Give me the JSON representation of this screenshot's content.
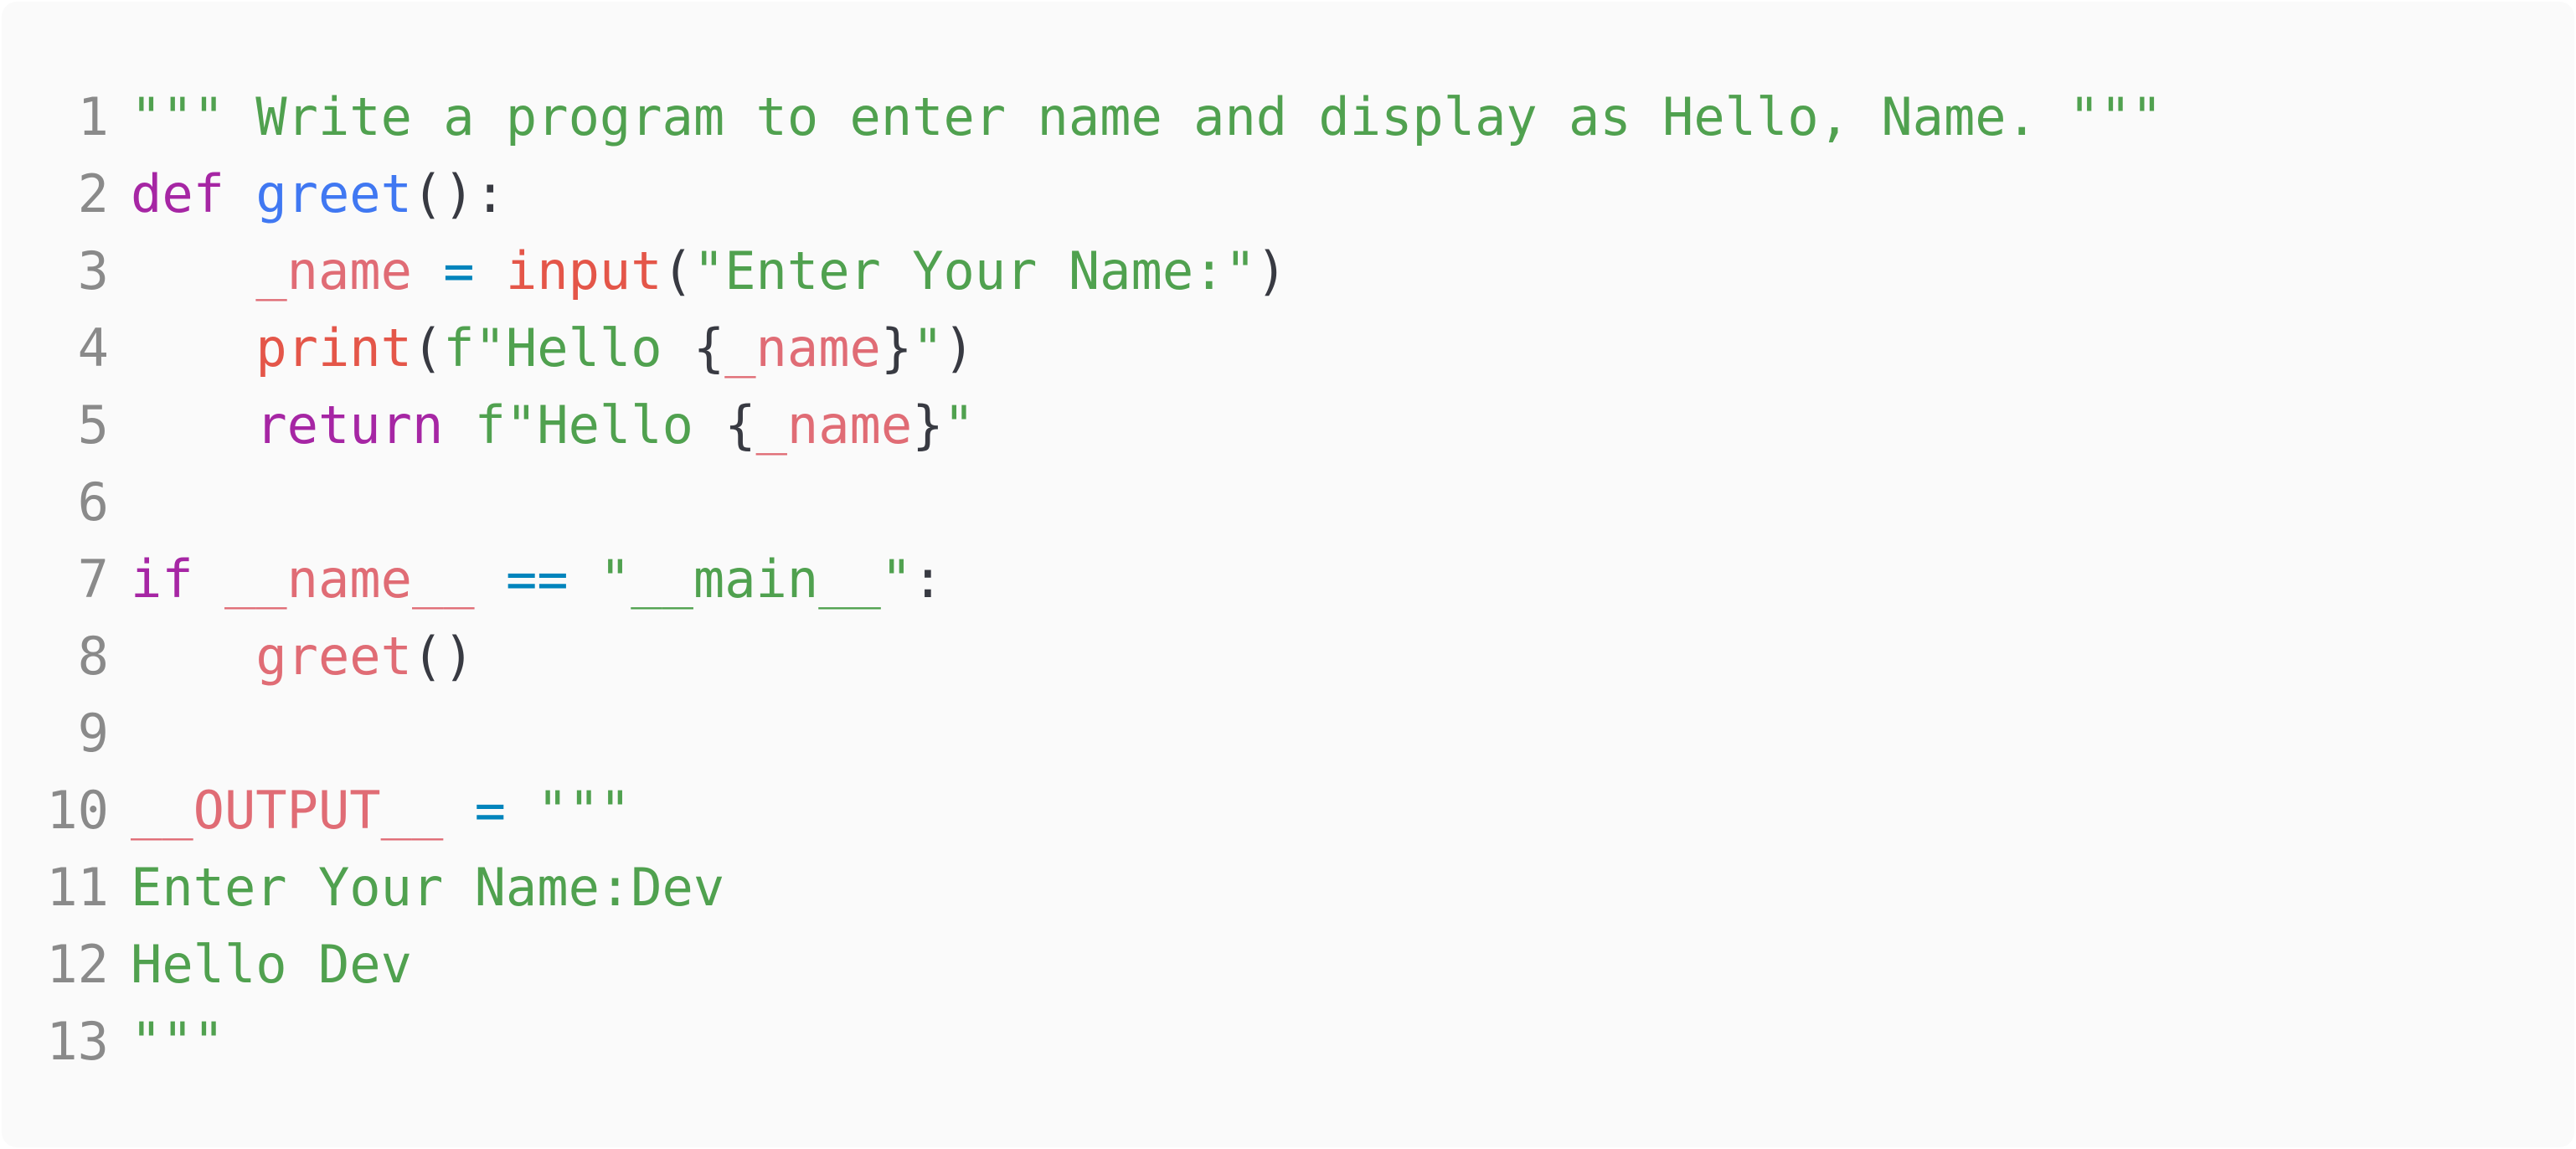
{
  "colors": {
    "background": "#fafafa",
    "line_number": "#8a8a8a",
    "default": "#383a42",
    "keyword": "#a626a4",
    "function_def": "#4078f2",
    "identifier": "#e45649",
    "string": "#50a14f",
    "operator": "#0184bc",
    "call": "#e06c75"
  },
  "lines": [
    {
      "num": "1",
      "tokens": [
        {
          "t": "\"\"\" Write a program to enter name and display as Hello, Name. \"\"\"",
          "k": "string"
        }
      ]
    },
    {
      "num": "2",
      "tokens": [
        {
          "t": "def",
          "k": "keyword"
        },
        {
          "t": " ",
          "k": "default"
        },
        {
          "t": "greet",
          "k": "function_def"
        },
        {
          "t": "():",
          "k": "default"
        }
      ]
    },
    {
      "num": "3",
      "tokens": [
        {
          "t": "    ",
          "k": "default"
        },
        {
          "t": "_name",
          "k": "call"
        },
        {
          "t": " ",
          "k": "default"
        },
        {
          "t": "=",
          "k": "operator"
        },
        {
          "t": " ",
          "k": "default"
        },
        {
          "t": "input",
          "k": "identifier"
        },
        {
          "t": "(",
          "k": "default"
        },
        {
          "t": "\"Enter Your Name:\"",
          "k": "string"
        },
        {
          "t": ")",
          "k": "default"
        }
      ]
    },
    {
      "num": "4",
      "tokens": [
        {
          "t": "    ",
          "k": "default"
        },
        {
          "t": "print",
          "k": "identifier"
        },
        {
          "t": "(",
          "k": "default"
        },
        {
          "t": "f\"Hello ",
          "k": "string"
        },
        {
          "t": "{",
          "k": "default"
        },
        {
          "t": "_name",
          "k": "call"
        },
        {
          "t": "}",
          "k": "default"
        },
        {
          "t": "\"",
          "k": "string"
        },
        {
          "t": ")",
          "k": "default"
        }
      ]
    },
    {
      "num": "5",
      "tokens": [
        {
          "t": "    ",
          "k": "default"
        },
        {
          "t": "return",
          "k": "keyword"
        },
        {
          "t": " ",
          "k": "default"
        },
        {
          "t": "f\"Hello ",
          "k": "string"
        },
        {
          "t": "{",
          "k": "default"
        },
        {
          "t": "_name",
          "k": "call"
        },
        {
          "t": "}",
          "k": "default"
        },
        {
          "t": "\"",
          "k": "string"
        }
      ]
    },
    {
      "num": "6",
      "tokens": []
    },
    {
      "num": "7",
      "tokens": [
        {
          "t": "if",
          "k": "keyword"
        },
        {
          "t": " ",
          "k": "default"
        },
        {
          "t": "__name__",
          "k": "call"
        },
        {
          "t": " ",
          "k": "default"
        },
        {
          "t": "==",
          "k": "operator"
        },
        {
          "t": " ",
          "k": "default"
        },
        {
          "t": "\"__main__\"",
          "k": "string"
        },
        {
          "t": ":",
          "k": "default"
        }
      ]
    },
    {
      "num": "8",
      "tokens": [
        {
          "t": "    ",
          "k": "default"
        },
        {
          "t": "greet",
          "k": "call"
        },
        {
          "t": "()",
          "k": "default"
        }
      ]
    },
    {
      "num": "9",
      "tokens": []
    },
    {
      "num": "10",
      "tokens": [
        {
          "t": "__OUTPUT__",
          "k": "call"
        },
        {
          "t": " ",
          "k": "default"
        },
        {
          "t": "=",
          "k": "operator"
        },
        {
          "t": " ",
          "k": "default"
        },
        {
          "t": "\"\"\"",
          "k": "string"
        }
      ]
    },
    {
      "num": "11",
      "tokens": [
        {
          "t": "Enter Your Name:Dev",
          "k": "string"
        }
      ]
    },
    {
      "num": "12",
      "tokens": [
        {
          "t": "Hello Dev",
          "k": "string"
        }
      ]
    },
    {
      "num": "13",
      "tokens": [
        {
          "t": "\"\"\"",
          "k": "string"
        }
      ]
    }
  ]
}
